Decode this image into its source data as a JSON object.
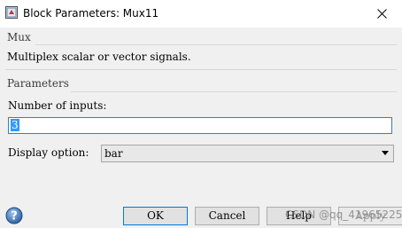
{
  "window": {
    "title": "Block Parameters: Mux11",
    "close_symbol": "✕"
  },
  "block": {
    "type_label": "Mux",
    "description": "Multiplex scalar or vector signals."
  },
  "parameters": {
    "section_label": "Parameters",
    "inputs_label": "Number of inputs:",
    "inputs_value": "3",
    "display_label": "Display option:",
    "display_value": "bar"
  },
  "buttons": {
    "ok": "OK",
    "cancel": "Cancel",
    "help": "Help",
    "apply": "Apply"
  },
  "watermark": "CSDN @qq_41965225",
  "colors": {
    "title_bar": "#ffffff",
    "dialog_bg": "#f0f0f0",
    "focus_border": "#0078d7",
    "selection": "#3399ff"
  },
  "icons": {
    "title": "simulink-block-icon",
    "close": "close-icon",
    "help": "help-circle-icon",
    "dropdown": "chevron-down-icon"
  }
}
